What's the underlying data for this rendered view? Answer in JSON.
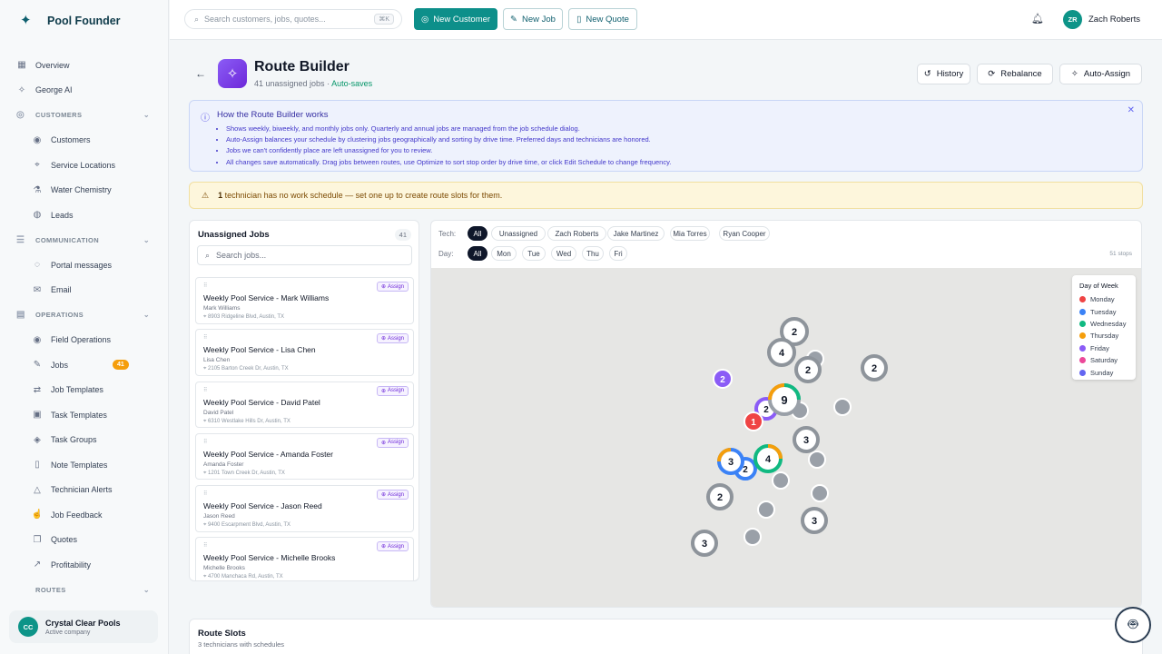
{
  "brand": {
    "name": "Pool Founder"
  },
  "sidebar": {
    "top": [
      {
        "label": "Overview",
        "icon": "grid-icon",
        "glyph": "▦"
      },
      {
        "label": "George AI",
        "icon": "sparkle-icon",
        "glyph": "✧"
      }
    ],
    "sections": [
      {
        "label": "CUSTOMERS",
        "icon": "user-circle-icon",
        "glyph": "◎",
        "items": [
          {
            "label": "Customers",
            "icon": "user-icon",
            "glyph": "◉"
          },
          {
            "label": "Service Locations",
            "icon": "map-pin-icon",
            "glyph": "⌖"
          },
          {
            "label": "Water Chemistry",
            "icon": "flask-icon",
            "glyph": "⚗"
          },
          {
            "label": "Leads",
            "icon": "globe-icon",
            "glyph": "◍"
          }
        ]
      },
      {
        "label": "COMMUNICATION",
        "icon": "chat-icon",
        "glyph": "☰",
        "items": [
          {
            "label": "Portal messages",
            "icon": "message-icon",
            "glyph": "◌"
          },
          {
            "label": "Email",
            "icon": "mail-icon",
            "glyph": "✉"
          }
        ]
      },
      {
        "label": "OPERATIONS",
        "icon": "layout-icon",
        "glyph": "▤",
        "items": [
          {
            "label": "Field Operations",
            "icon": "signal-icon",
            "glyph": "◉"
          },
          {
            "label": "Jobs",
            "icon": "wrench-icon",
            "glyph": "✎",
            "badge": "41"
          },
          {
            "label": "Job Templates",
            "icon": "repeat-icon",
            "glyph": "⇄"
          },
          {
            "label": "Task Templates",
            "icon": "clipboard-icon",
            "glyph": "▣"
          },
          {
            "label": "Task Groups",
            "icon": "layers-icon",
            "glyph": "◈"
          },
          {
            "label": "Note Templates",
            "icon": "file-icon",
            "glyph": "▯"
          },
          {
            "label": "Technician Alerts",
            "icon": "alert-icon",
            "glyph": "△"
          },
          {
            "label": "Job Feedback",
            "icon": "thumbs-up-icon",
            "glyph": "☝"
          },
          {
            "label": "Quotes",
            "icon": "quote-icon",
            "glyph": "❐"
          },
          {
            "label": "Profitability",
            "icon": "trend-icon",
            "glyph": "↗"
          }
        ]
      },
      {
        "label": "ROUTES",
        "icon": "",
        "glyph": "",
        "items": []
      }
    ],
    "company": {
      "initials": "CC",
      "name": "Crystal Clear Pools",
      "sub": "Active company"
    }
  },
  "topbar": {
    "search_placeholder": "Search customers, jobs, quotes...",
    "shortcut": "⌘K",
    "new_customer": "New Customer",
    "new_job": "New Job",
    "new_quote": "New Quote",
    "user_initials": "ZR",
    "user_name": "Zach Roberts"
  },
  "header": {
    "title": "Route Builder",
    "subtitle_count": "41 unassigned jobs",
    "subtitle_sep": " · ",
    "subtitle_status": "Auto-saves",
    "history": "History",
    "rebalance": "Rebalance",
    "auto_assign": "Auto-Assign"
  },
  "info": {
    "title": "How the Route Builder works",
    "bullets": [
      "Shows weekly, biweekly, and monthly jobs only. Quarterly and annual jobs are managed from the job schedule dialog.",
      "Auto-Assign balances your schedule by clustering jobs geographically and sorting by drive time. Preferred days and technicians are honored.",
      "Jobs we can't confidently place are left unassigned for you to review.",
      "All changes save automatically. Drag jobs between routes, use Optimize to sort stop order by drive time, or click Edit Schedule to change frequency."
    ]
  },
  "warning": {
    "count": "1",
    "text": " technician has no work schedule — set one up to create route slots for them."
  },
  "unassigned": {
    "title": "Unassigned Jobs",
    "count": "41",
    "search_placeholder": "Search jobs...",
    "assign_label": "Assign",
    "jobs": [
      {
        "title": "Weekly Pool Service - Mark Williams",
        "name": "Mark Williams",
        "address": "8903 Ridgeline Blvd, Austin, TX"
      },
      {
        "title": "Weekly Pool Service - Lisa Chen",
        "name": "Lisa Chen",
        "address": "2105 Barton Creek Dr, Austin, TX"
      },
      {
        "title": "Weekly Pool Service - David Patel",
        "name": "David Patel",
        "address": "6310 Westlake Hills Dr, Austin, TX"
      },
      {
        "title": "Weekly Pool Service - Amanda Foster",
        "name": "Amanda Foster",
        "address": "1201 Town Creek Dr, Austin, TX"
      },
      {
        "title": "Weekly Pool Service - Jason Reed",
        "name": "Jason Reed",
        "address": "9400 Escarpment Blvd, Austin, TX"
      },
      {
        "title": "Weekly Pool Service - Michelle Brooks",
        "name": "Michelle Brooks",
        "address": "4700 Manchaca Rd, Austin, TX"
      }
    ]
  },
  "filters": {
    "tech_label": "Tech:",
    "tech_options": [
      "All",
      "Unassigned",
      "Zach Roberts",
      "Jake Martinez",
      "Mia Torres",
      "Ryan Cooper"
    ],
    "tech_selected": "All",
    "day_label": "Day:",
    "day_options": [
      "All",
      "Mon",
      "Tue",
      "Wed",
      "Thu",
      "Fri"
    ],
    "day_selected": "All",
    "stops": "51 stops"
  },
  "legend": {
    "title": "Day of Week",
    "items": [
      {
        "label": "Monday",
        "color": "#ef4444"
      },
      {
        "label": "Tuesday",
        "color": "#3b82f6"
      },
      {
        "label": "Wednesday",
        "color": "#10b981"
      },
      {
        "label": "Thursday",
        "color": "#f59e0b"
      },
      {
        "label": "Friday",
        "color": "#8b5cf6"
      },
      {
        "label": "Saturday",
        "color": "#ec4899"
      },
      {
        "label": "Sunday",
        "color": "#6366f1"
      }
    ]
  },
  "route_slots": {
    "title": "Route Slots",
    "sub": "3 technicians with schedules"
  }
}
